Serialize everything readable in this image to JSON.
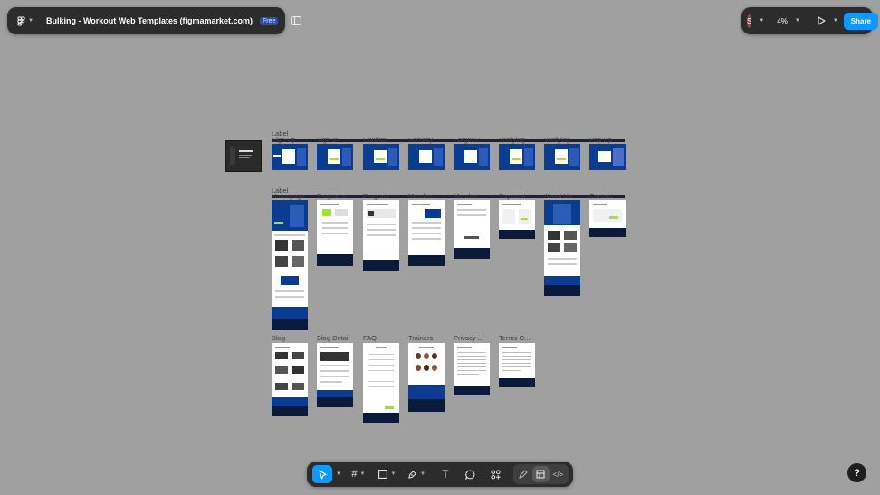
{
  "header": {
    "file_name": "Bulking - Workout Web Templates (figmamarket.com)",
    "plan_badge": "Free",
    "avatar_initial": "S",
    "zoom": "4%",
    "share_label": "Share"
  },
  "canvas": {
    "section_labels": [
      "Label",
      "Label"
    ],
    "row1_labels": [
      "Sign Up",
      "Sign In",
      "Confirm",
      "Security",
      "Forgot P...",
      "Verifying",
      "Verifying",
      "Pop Up"
    ],
    "row2_labels": [
      "Homepage",
      "Programs",
      "Program",
      "Member...",
      "Member...",
      "Payment",
      "About Us",
      "Contact"
    ],
    "row3_labels": [
      "Blog",
      "Blog Detail",
      "FAQ",
      "Trainers",
      "Privacy ...",
      "Terms O..."
    ]
  },
  "toolbar": {
    "tools": [
      "move-tool",
      "frame-tool",
      "shape-tool",
      "pen-tool",
      "text-tool",
      "comment-tool",
      "actions-tool"
    ],
    "modes": [
      "draw-mode",
      "design-mode",
      "dev-mode"
    ]
  },
  "help_label": "?",
  "colors": {
    "canvas_bg": "#a0a0a0",
    "panel_bg": "#2c2c2c",
    "accent": "#0d99ff",
    "frame_blue": "#0a3d91",
    "frame_dark": "#0b1a3a",
    "lime": "#a6e22e"
  }
}
